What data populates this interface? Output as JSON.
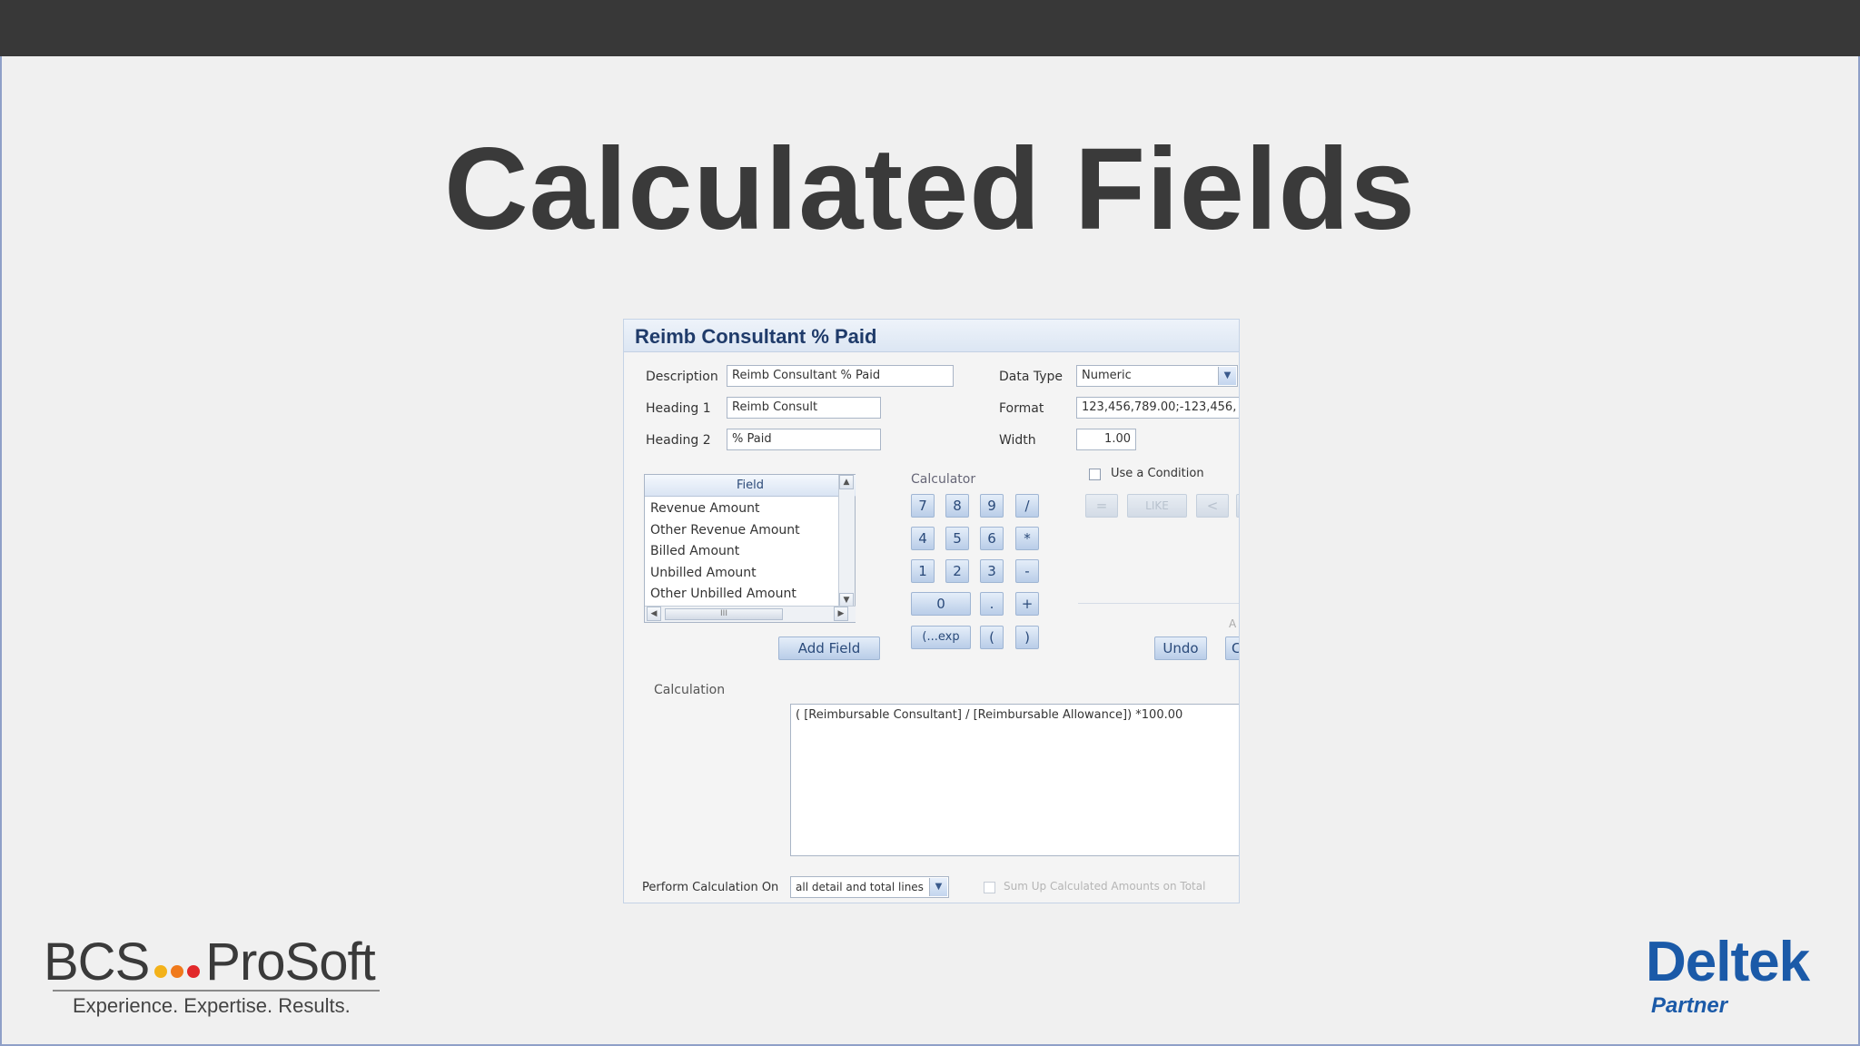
{
  "slide": {
    "title": "Calculated Fields"
  },
  "dialog": {
    "title": "Reimb Consultant % Paid",
    "description": {
      "label": "Description",
      "value": "Reimb Consultant % Paid"
    },
    "heading1": {
      "label": "Heading 1",
      "value": "Reimb Consult"
    },
    "heading2": {
      "label": "Heading 2",
      "value": "% Paid"
    },
    "data_type": {
      "label": "Data Type",
      "value": "Numeric"
    },
    "format": {
      "label": "Format",
      "value": "123,456,789.00;-123,456,"
    },
    "width": {
      "label": "Width",
      "value": "1.00"
    },
    "field_list": {
      "header": "Field",
      "items": [
        "Revenue Amount",
        "Other Revenue Amount",
        "Billed Amount",
        "Unbilled Amount",
        "Other Unbilled Amount"
      ],
      "hscroll_grip": "III"
    },
    "add_field_label": "Add Field",
    "calculator": {
      "label": "Calculator",
      "keys": [
        "7",
        "8",
        "9",
        "/",
        "4",
        "5",
        "6",
        "*",
        "1",
        "2",
        "3",
        "-",
        "0",
        ".",
        "+",
        "(...exp",
        "(",
        ")"
      ]
    },
    "condition": {
      "checkbox_label": "Use a Condition",
      "op_buttons": [
        "=",
        "LIKE",
        "<"
      ],
      "partial_label": "A"
    },
    "undo_label": "Undo",
    "clear_partial_label": "C",
    "calculation": {
      "label": "Calculation",
      "value": "( [Reimbursable Consultant] / [Reimbursable Allowance]) *100.00"
    },
    "perform_on": {
      "label": "Perform Calculation On",
      "value": "all detail and total lines"
    },
    "sum_up": {
      "label": "Sum Up Calculated Amounts on Total"
    }
  },
  "logos": {
    "bcs_left": "BCS",
    "bcs_right": "ProSoft",
    "bcs_tagline": "Experience. Expertise. Results.",
    "dot_colors": [
      "#f3b21a",
      "#f07a1c",
      "#e2292b"
    ],
    "deltek": "Deltek",
    "deltek_sub": "Partner"
  }
}
